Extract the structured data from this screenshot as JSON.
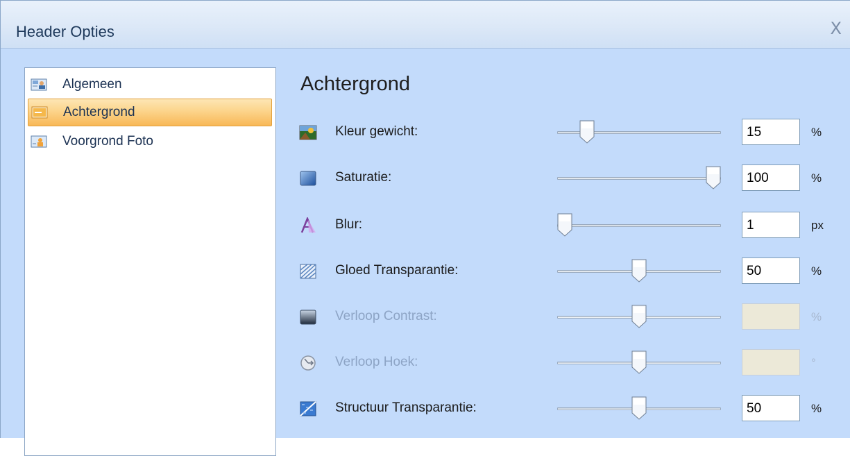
{
  "window": {
    "title": "Header Opties",
    "close_label": "X"
  },
  "sidebar": {
    "items": [
      {
        "label": "Algemeen",
        "icon": "general-icon",
        "selected": false
      },
      {
        "label": "Achtergrond",
        "icon": "background-icon",
        "selected": true
      },
      {
        "label": "Voorgrond Foto",
        "icon": "foreground-photo-icon",
        "selected": false
      }
    ]
  },
  "main": {
    "title": "Achtergrond",
    "rows": [
      {
        "label": "Kleur gewicht:",
        "icon": "color-weight-icon",
        "value": "15",
        "unit": "%",
        "slider": 0.15,
        "enabled": true
      },
      {
        "label": "Saturatie:",
        "icon": "saturation-icon",
        "value": "100",
        "unit": "%",
        "slider": 1.0,
        "enabled": true
      },
      {
        "label": "Blur:",
        "icon": "blur-icon",
        "value": "1",
        "unit": "px",
        "slider": 0.0,
        "enabled": true
      },
      {
        "label": "Gloed Transparantie:",
        "icon": "glow-transparency-icon",
        "value": "50",
        "unit": "%",
        "slider": 0.5,
        "enabled": true
      },
      {
        "label": "Verloop Contrast:",
        "icon": "gradient-contrast-icon",
        "value": "",
        "unit": "%",
        "slider": 0.5,
        "enabled": false
      },
      {
        "label": "Verloop Hoek:",
        "icon": "gradient-angle-icon",
        "value": "",
        "unit": "°",
        "slider": 0.5,
        "enabled": false
      },
      {
        "label": "Structuur Transparantie:",
        "icon": "texture-transparency-icon",
        "value": "50",
        "unit": "%",
        "slider": 0.5,
        "enabled": true
      }
    ]
  },
  "colors": {
    "window_bg": "#c3dbfb",
    "selection": "#fcd48b",
    "disabled_text": "#8da4c5"
  }
}
